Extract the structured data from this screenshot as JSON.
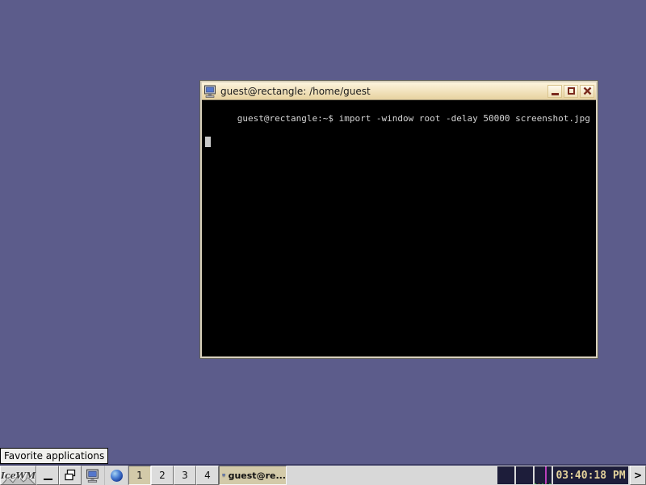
{
  "desktop": {
    "background_color": "#5c5c8b"
  },
  "tooltip": {
    "text": "Favorite applications"
  },
  "terminal_window": {
    "title": "guest@rectangle: /home/guest",
    "window_icon": "terminal-monitor-icon",
    "controls": {
      "minimize": "minimize-icon",
      "maximize": "maximize-icon",
      "close": "close-icon"
    },
    "content": {
      "prompt_line": "guest@rectangle:~$ import -window root -delay 50000 screenshot.jpg",
      "cursor": "block"
    }
  },
  "taskbar": {
    "start_button": {
      "label": "IceWM",
      "icon": "icewm-logo"
    },
    "show_desktop": {
      "icon": "underscore-icon"
    },
    "window_list": {
      "icon": "windows-cascade-icon"
    },
    "quick_launch": [
      {
        "name": "terminal",
        "icon": "terminal-monitor-icon"
      },
      {
        "name": "browser",
        "icon": "globe-icon"
      }
    ],
    "workspaces": [
      {
        "label": "1",
        "active": true
      },
      {
        "label": "2",
        "active": false
      },
      {
        "label": "3",
        "active": false
      },
      {
        "label": "4",
        "active": false
      }
    ],
    "task_button": {
      "label": "guest@re...",
      "icon": "terminal-monitor-icon",
      "active": true
    },
    "tray_monitors": [
      {
        "name": "net-monitor-1"
      },
      {
        "name": "net-monitor-2"
      },
      {
        "name": "cpu-monitor"
      }
    ],
    "clock": "03:40:18 PM",
    "expand_label": ">"
  },
  "colors": {
    "desktop": "#5c5c8b",
    "taskbar_bg": "#d8d8d8",
    "titlebar_gradient_top": "#fdf4dd",
    "titlebar_gradient_bottom": "#e7d2a0",
    "window_glyphs": "#7a2a1d",
    "active_button_bg": "#d3caa9",
    "tray_bg": "#1d1d3a",
    "clock_text": "#e6d49c",
    "cpu_line": "#bb3fbb"
  }
}
